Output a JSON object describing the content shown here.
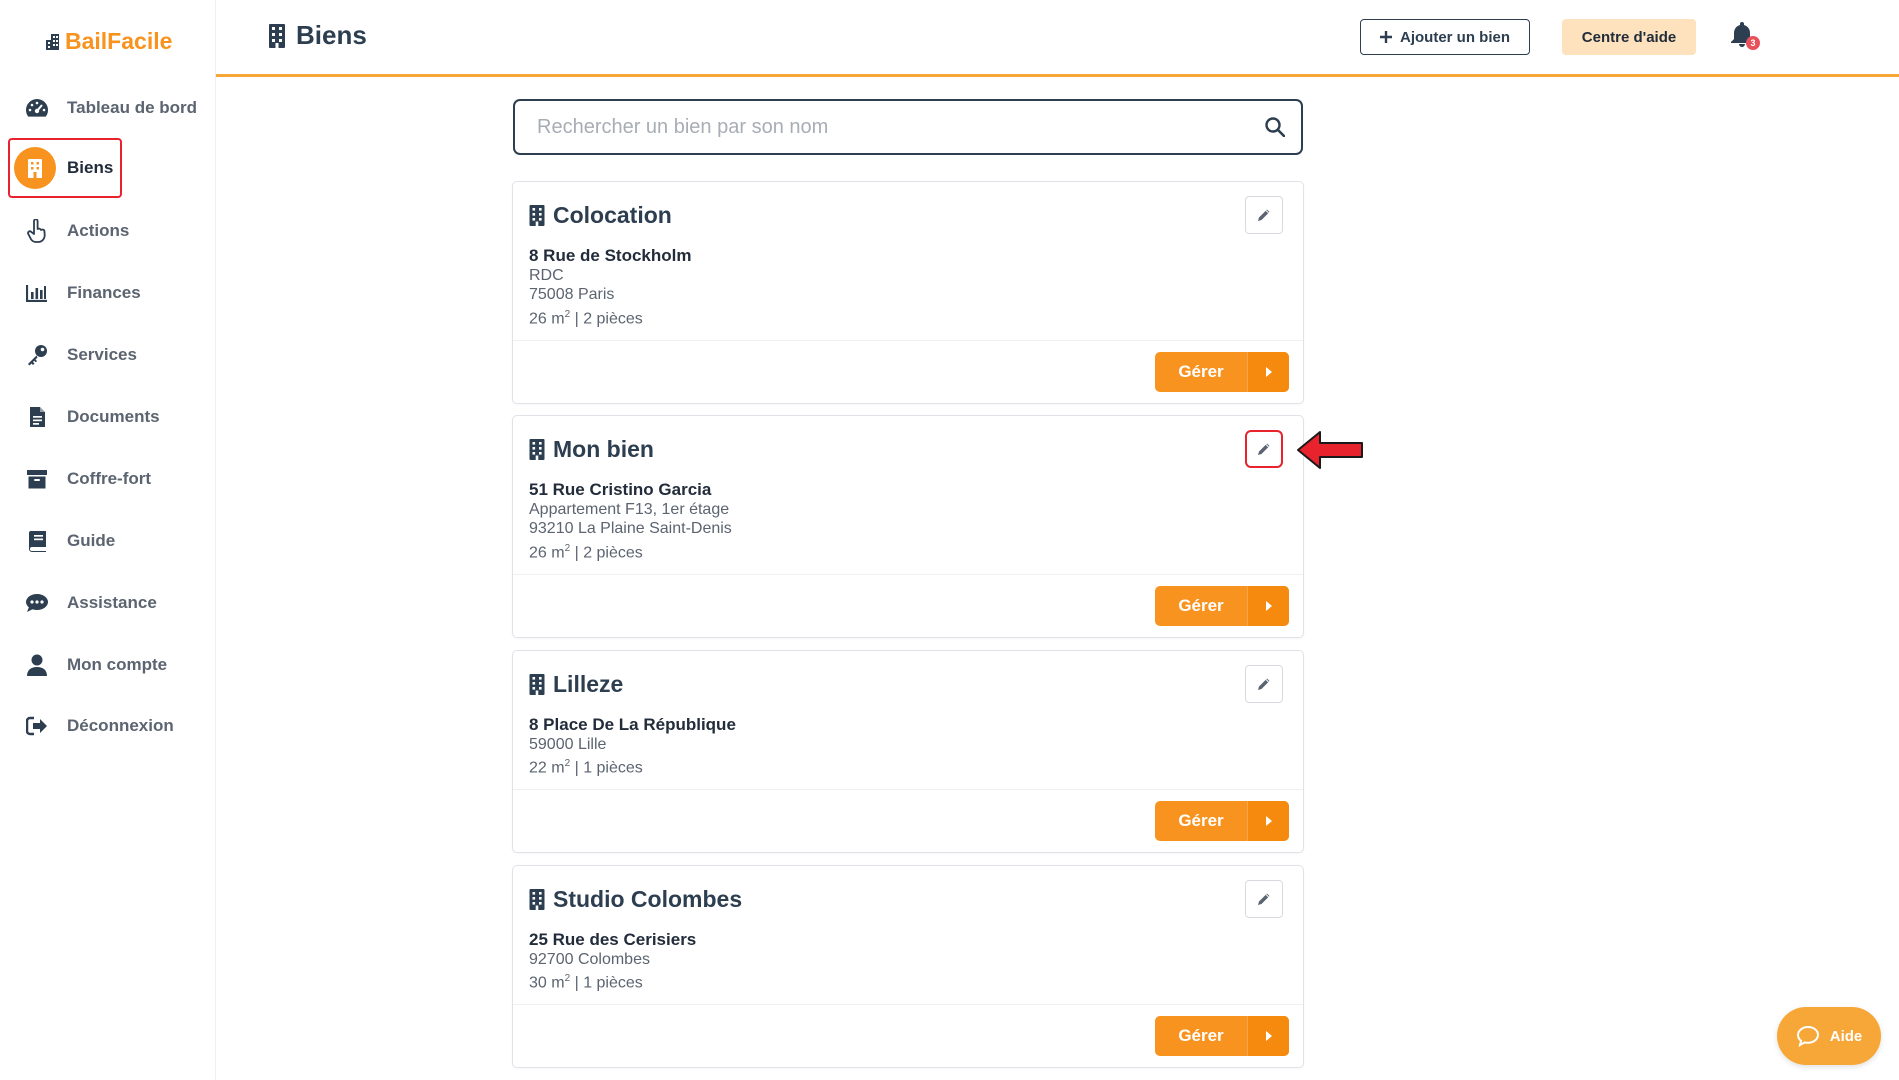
{
  "brand": {
    "name": "BailFacile",
    "accent": "#f7931e"
  },
  "sidebar": {
    "items": [
      {
        "label": "Tableau de bord",
        "icon": "dashboard-icon"
      },
      {
        "label": "Biens",
        "icon": "building-icon",
        "active": true
      },
      {
        "label": "Actions",
        "icon": "pointer-hand-icon"
      },
      {
        "label": "Finances",
        "icon": "bar-chart-icon"
      },
      {
        "label": "Services",
        "icon": "key-icon"
      },
      {
        "label": "Documents",
        "icon": "document-icon"
      },
      {
        "label": "Coffre-fort",
        "icon": "archive-icon"
      },
      {
        "label": "Guide",
        "icon": "book-icon"
      },
      {
        "label": "Assistance",
        "icon": "chat-icon"
      },
      {
        "label": "Mon compte",
        "icon": "user-icon"
      },
      {
        "label": "Déconnexion",
        "icon": "logout-icon"
      }
    ]
  },
  "header": {
    "title": "Biens",
    "add_button": "Ajouter un bien",
    "help_button": "Centre d'aide",
    "notifications_count": "3"
  },
  "search": {
    "placeholder": "Rechercher un bien par son nom",
    "value": ""
  },
  "properties": [
    {
      "name": "Colocation",
      "street": "8 Rue de Stockholm",
      "lines": [
        "RDC",
        "75008 Paris"
      ],
      "surface": "26 m",
      "rooms": " | 2 pièces",
      "manage_label": "Gérer"
    },
    {
      "name": "Mon bien",
      "street": "51 Rue Cristino Garcia",
      "lines": [
        "Appartement F13, 1er étage",
        "93210 La Plaine Saint-Denis"
      ],
      "surface": "26 m",
      "rooms": " | 2 pièces",
      "manage_label": "Gérer"
    },
    {
      "name": "Lilleze",
      "street": "8 Place De La République",
      "lines": [
        "59000 Lille"
      ],
      "surface": "22 m",
      "rooms": " | 1 pièces",
      "manage_label": "Gérer"
    },
    {
      "name": "Studio Colombes",
      "street": "25 Rue des Cerisiers",
      "lines": [
        "92700 Colombes"
      ],
      "surface": "30 m",
      "rooms": " | 1 pièces",
      "manage_label": "Gérer"
    }
  ],
  "surface_unit_sup": "2",
  "aide_button": "Aide"
}
